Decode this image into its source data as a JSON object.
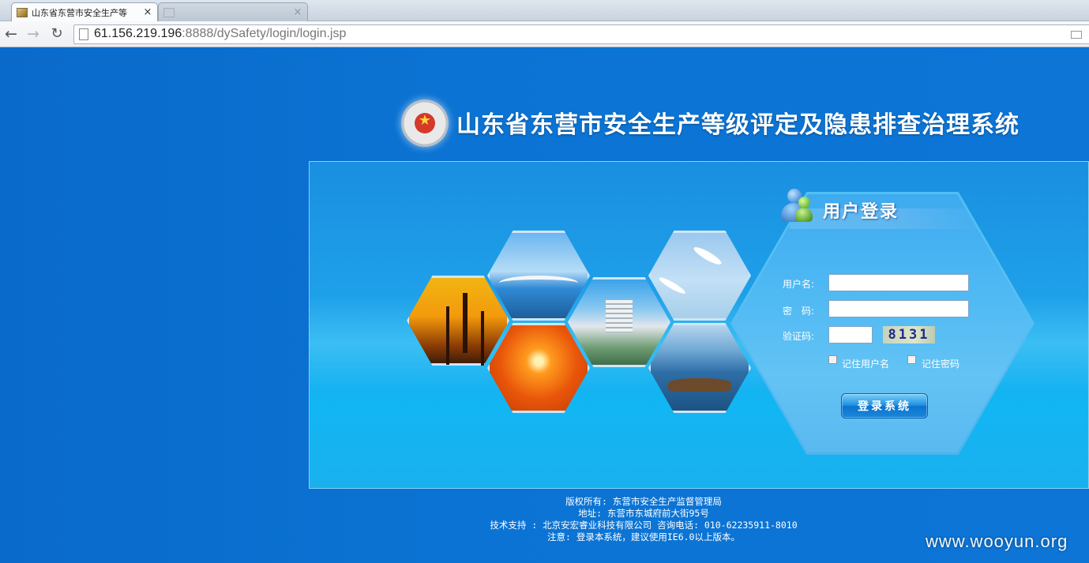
{
  "browser": {
    "tabs": [
      {
        "title": "山东省东营市安全生产等",
        "close": "×",
        "active": true
      },
      {
        "title": "",
        "close": "×",
        "active": false
      }
    ],
    "nav": {
      "back": "←",
      "forward": "→",
      "reload": "↻"
    },
    "url_host": "61.156.219.196",
    "url_rest": ":8888/dySafety/login/login.jsp"
  },
  "header": {
    "system_title": "山东省东营市安全生产等级评定及隐患排查治理系统"
  },
  "login": {
    "title": "用户登录",
    "username_label": "用户名:",
    "username_value": "",
    "password_label": "密　码:",
    "password_value": "",
    "captcha_label": "验证码:",
    "captcha_value": "",
    "captcha_image_text": "8131",
    "remember_user_label": "记住用户名",
    "remember_password_label": "记住密码",
    "submit_label": "登录系统"
  },
  "footer": {
    "copyright": "版权所有: 东营市安全生产监督管理局",
    "address": "地址: 东营市东城府前大街95号",
    "support": "技术支持 : 北京安宏睿业科技有限公司 咨询电话: 010-62235911-8010",
    "notice": "注意: 登录本系统，建议使用IE6.0以上版本。"
  },
  "watermark": "www.wooyun.org",
  "colors": {
    "page_background": "#0a6fcf",
    "panel": "#1fa2ea",
    "button": "#1e8fe0"
  }
}
